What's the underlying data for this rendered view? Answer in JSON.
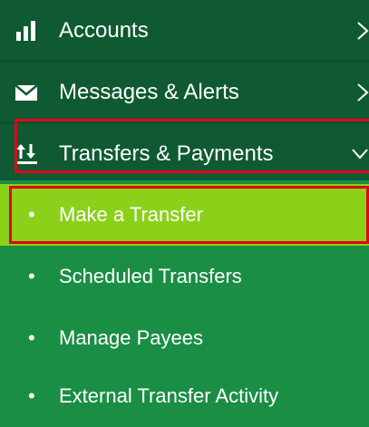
{
  "colors": {
    "main_bg": "#0f5a32",
    "sub_bg": "#1b8e45",
    "active_bg": "#8bd11a",
    "highlight": "#e2001a",
    "text": "#ffffff"
  },
  "nav": {
    "main_items": [
      {
        "label": "Accounts",
        "icon": "bar-chart-icon",
        "chevron": "chevron-right-icon"
      },
      {
        "label": "Messages & Alerts",
        "icon": "envelope-icon",
        "chevron": "chevron-right-icon"
      },
      {
        "label": "Transfers & Payments",
        "icon": "transfer-arrows-icon",
        "chevron": "chevron-down-icon"
      }
    ],
    "sub_items": [
      {
        "label": "Make a Transfer",
        "bullet": "•",
        "active": true
      },
      {
        "label": "Scheduled Transfers",
        "bullet": "•",
        "active": false
      },
      {
        "label": "Manage Payees",
        "bullet": "•",
        "active": false
      },
      {
        "label": "External Transfer Activity",
        "bullet": "•",
        "active": false
      }
    ]
  }
}
